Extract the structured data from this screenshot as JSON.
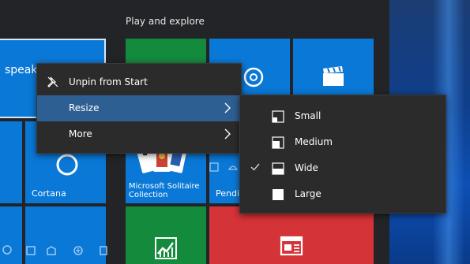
{
  "start": {
    "group_label": "Play and explore",
    "tiles": {
      "speak_text": "speak",
      "cortana_label": "Cortana",
      "solitaire_label": "Microsoft Solitaire Collection",
      "pending_label": "Pendi"
    }
  },
  "context_menu": {
    "items": [
      {
        "label": "Unpin from Start",
        "icon": "unpin-icon"
      },
      {
        "label": "Resize",
        "icon": "chevron-right-icon"
      },
      {
        "label": "More",
        "icon": "chevron-right-icon"
      }
    ]
  },
  "resize_menu": {
    "items": [
      {
        "label": "Small",
        "icon": "small-size-icon",
        "checked": false
      },
      {
        "label": "Medium",
        "icon": "medium-size-icon",
        "checked": false
      },
      {
        "label": "Wide",
        "icon": "wide-size-icon",
        "checked": true
      },
      {
        "label": "Large",
        "icon": "large-size-icon",
        "checked": false
      }
    ]
  },
  "colors": {
    "tile_blue": "#0a78d7",
    "tile_green": "#138a3c",
    "tile_red": "#d43337",
    "menu_bg": "#2b2b2b",
    "menu_selected": "#2e5f92"
  }
}
